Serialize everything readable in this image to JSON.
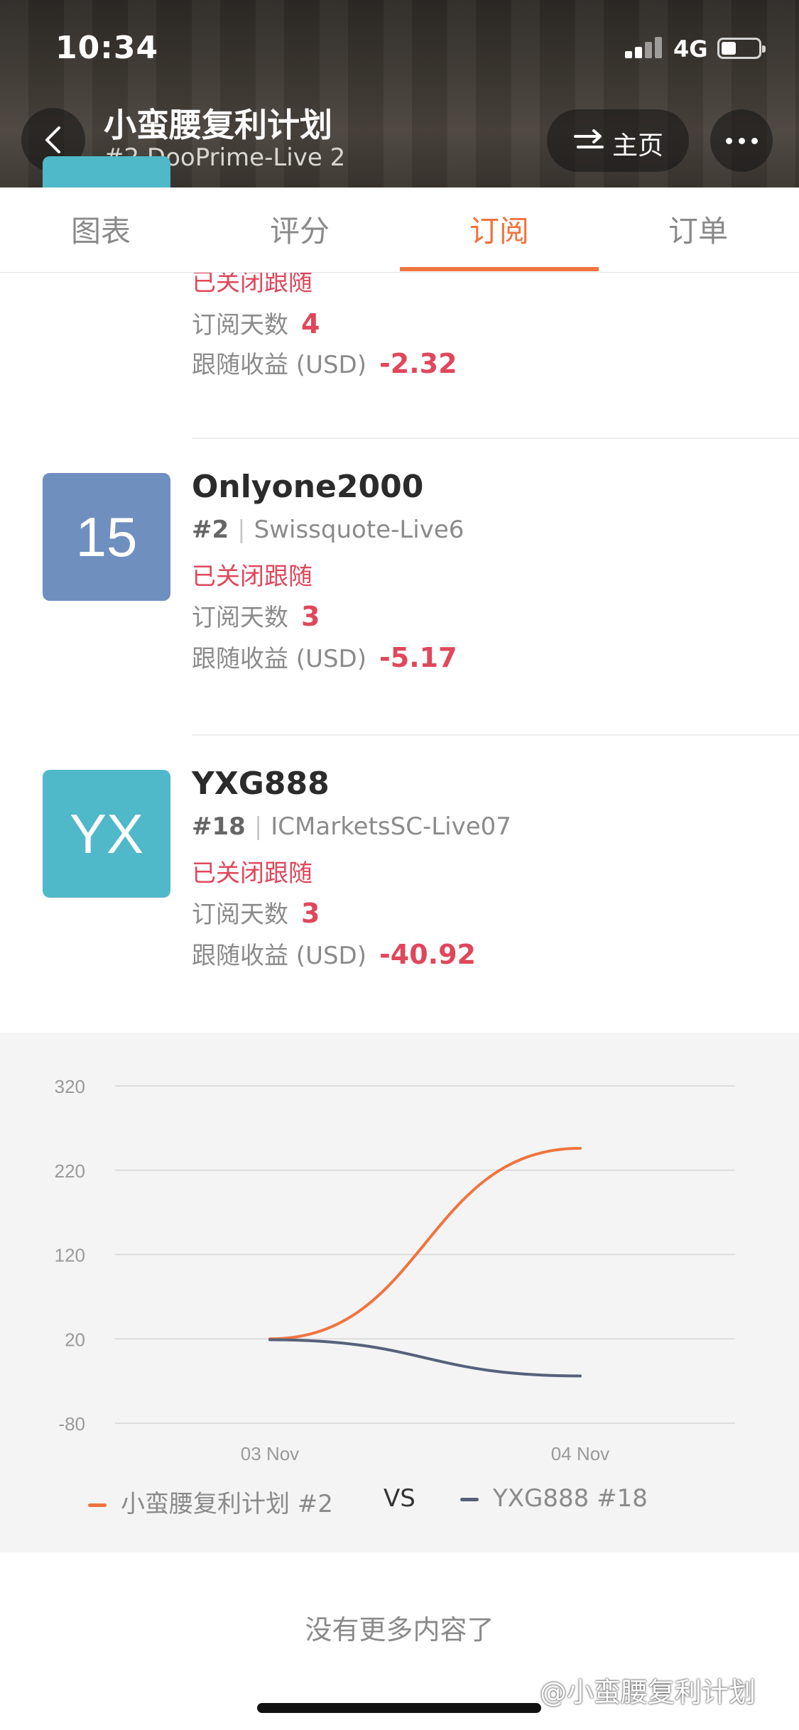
{
  "status_bar": {
    "time": "10:34",
    "network": "4G"
  },
  "header": {
    "title": "小蛮腰复利计划",
    "subtitle": "#2 DooPrime-Live 2",
    "home_label": "主页"
  },
  "tabs": [
    {
      "label": "图表"
    },
    {
      "label": "评分"
    },
    {
      "label": "订阅"
    },
    {
      "label": "订单"
    }
  ],
  "active_tab": "订阅",
  "partial_card": {
    "status": "已关闭跟随",
    "days_label": "订阅天数",
    "days": "4",
    "profit_label": "跟随收益 (USD)",
    "profit": "-2.32"
  },
  "subscribers": [
    {
      "avatar_text": "15",
      "avatar_color": "#6f8fbe",
      "name": "Onlyone2000",
      "rank": "#2",
      "broker": "Swissquote-Live6",
      "status": "已关闭跟随",
      "days_label": "订阅天数",
      "days": "3",
      "profit_label": "跟随收益 (USD)",
      "profit": "-5.17"
    },
    {
      "avatar_text": "YX",
      "avatar_color": "#4fb8c9",
      "name": "YXG888",
      "rank": "#18",
      "broker": "ICMarketsSC-Live07",
      "status": "已关闭跟随",
      "days_label": "订阅天数",
      "days": "3",
      "profit_label": "跟随收益 (USD)",
      "profit": "-40.92"
    }
  ],
  "chart_data": {
    "type": "line",
    "x": [
      "03 Nov",
      "04 Nov"
    ],
    "y_ticks": [
      "320",
      "220",
      "120",
      "20",
      "-80"
    ],
    "ylim": [
      -80,
      320
    ],
    "grid": true,
    "series": [
      {
        "name": "小蛮腰复利计划 #2",
        "color": "#f0743f",
        "values": [
          20,
          246
        ]
      },
      {
        "name": "YXG888 #18",
        "color": "#56617a",
        "values": [
          19,
          -24
        ]
      }
    ],
    "legend_separator": "VS",
    "legend_position": "bottom"
  },
  "footer_note": "没有更多内容了",
  "watermark": "@小蛮腰复利计划",
  "colors": {
    "accent": "#f0743f",
    "negative": "#e0475b"
  }
}
